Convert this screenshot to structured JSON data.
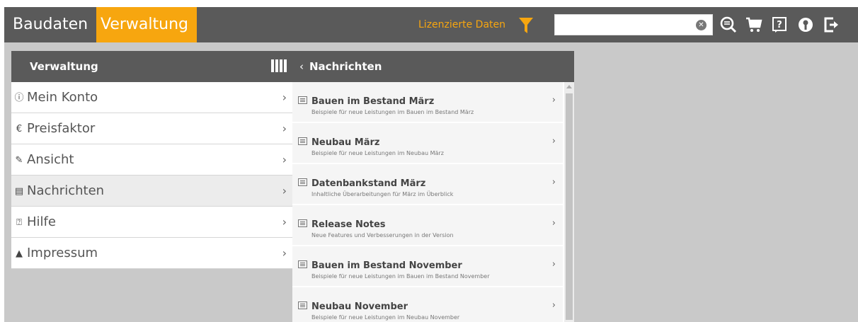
{
  "header": {
    "tabs": [
      {
        "label": "Baudaten"
      },
      {
        "label": "Verwaltung"
      }
    ],
    "licensed_label": "Lizenzierte Daten",
    "search": {
      "value": "",
      "placeholder": ""
    },
    "accent": "#f7a60f",
    "bar_color": "#5a5a5a",
    "icons": [
      "filter-icon",
      "clear-icon",
      "search-list-icon",
      "cart-icon",
      "help-icon",
      "user-icon",
      "logout-icon"
    ]
  },
  "left_panel": {
    "title": "Verwaltung",
    "items": [
      {
        "label": "Mein Konto",
        "icon": "user-icon"
      },
      {
        "label": "Preisfaktor",
        "icon": "euro-icon"
      },
      {
        "label": "Ansicht",
        "icon": "wrench-icon"
      },
      {
        "label": "Nachrichten",
        "icon": "news-icon"
      },
      {
        "label": "Hilfe",
        "icon": "help-icon"
      },
      {
        "label": "Impressum",
        "icon": "imprint-icon"
      }
    ]
  },
  "right_panel": {
    "title": "Nachrichten",
    "items": [
      {
        "title": "Bauen im Bestand März",
        "subtitle": "Beispiele für neue Leistungen im Bauen im Bestand März"
      },
      {
        "title": "Neubau März",
        "subtitle": "Beispiele für neue Leistungen im Neubau März"
      },
      {
        "title": "Datenbankstand März",
        "subtitle": "Inhaltliche Überarbeitungen für März im Überblick"
      },
      {
        "title": "Release Notes",
        "subtitle": "Neue Features und Verbesserungen in der Version"
      },
      {
        "title": "Bauen im Bestand November",
        "subtitle": "Beispiele für neue Leistungen im Bauen im Bestand November"
      },
      {
        "title": "Neubau November",
        "subtitle": "Beispiele für neue Leistungen im Neubau November"
      }
    ]
  }
}
